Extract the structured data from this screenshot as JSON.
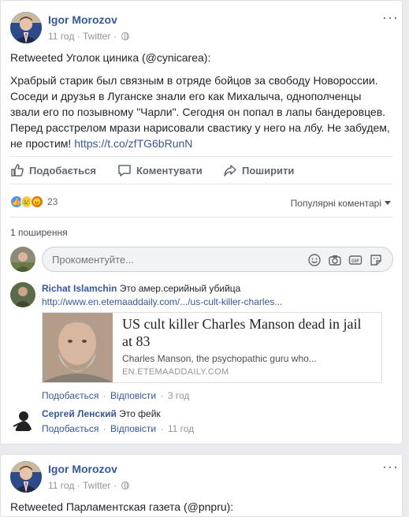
{
  "post1": {
    "author": "Igor Morozov",
    "time": "11 год",
    "source": "Twitter",
    "retweet": "Retweeted Уголок циника (@cynicarea):",
    "text_lines": [
      "Храбрый старик был связным в отряде бойцов за свободу Новороссии.",
      "Соседи и друзья в Луганске знали его как Михалыча, однополченцы",
      "звали его по позывному \"Чарли\". Сегодня он попал в лапы бандеровцев.",
      "Перед расстрелом мрази нарисовали свастику у него на лбу. Не забудем,"
    ],
    "text_last": "не простим!",
    "link": "https://t.co/zfTG6bRunN",
    "actions": {
      "like": "Подобається",
      "comment": "Коментувати",
      "share": "Поширити"
    },
    "reaction_count": "23",
    "sort_label": "Популярні коментарі",
    "shares_label": "1 поширення",
    "comment_placeholder": "Прокоментуйте...",
    "comments": [
      {
        "name": "Richat Islamchin",
        "text": "Это амер.серийный убийца",
        "link": "http://www.en.etemaaddaily.com/.../us-cult-killer-charles...",
        "preview": {
          "title": "US cult killer Charles Manson dead in jail at 83",
          "desc": "Charles Manson, the psychopathic guru who...",
          "domain": "EN.ETEMAADDAILY.COM"
        },
        "like": "Подобається",
        "reply": "Відповісти",
        "time": "3 год"
      },
      {
        "name": "Сергей Ленский",
        "text": "Это фейк",
        "like": "Подобається",
        "reply": "Відповісти",
        "time": "11 год"
      }
    ]
  },
  "post2": {
    "author": "Igor Morozov",
    "time": "11 год",
    "source": "Twitter",
    "retweet": "Retweeted Парламентская газета (@pnpru):"
  },
  "colors": {
    "link": "#365899",
    "like_blue": "#5890ff",
    "background": "#e9ebee"
  }
}
